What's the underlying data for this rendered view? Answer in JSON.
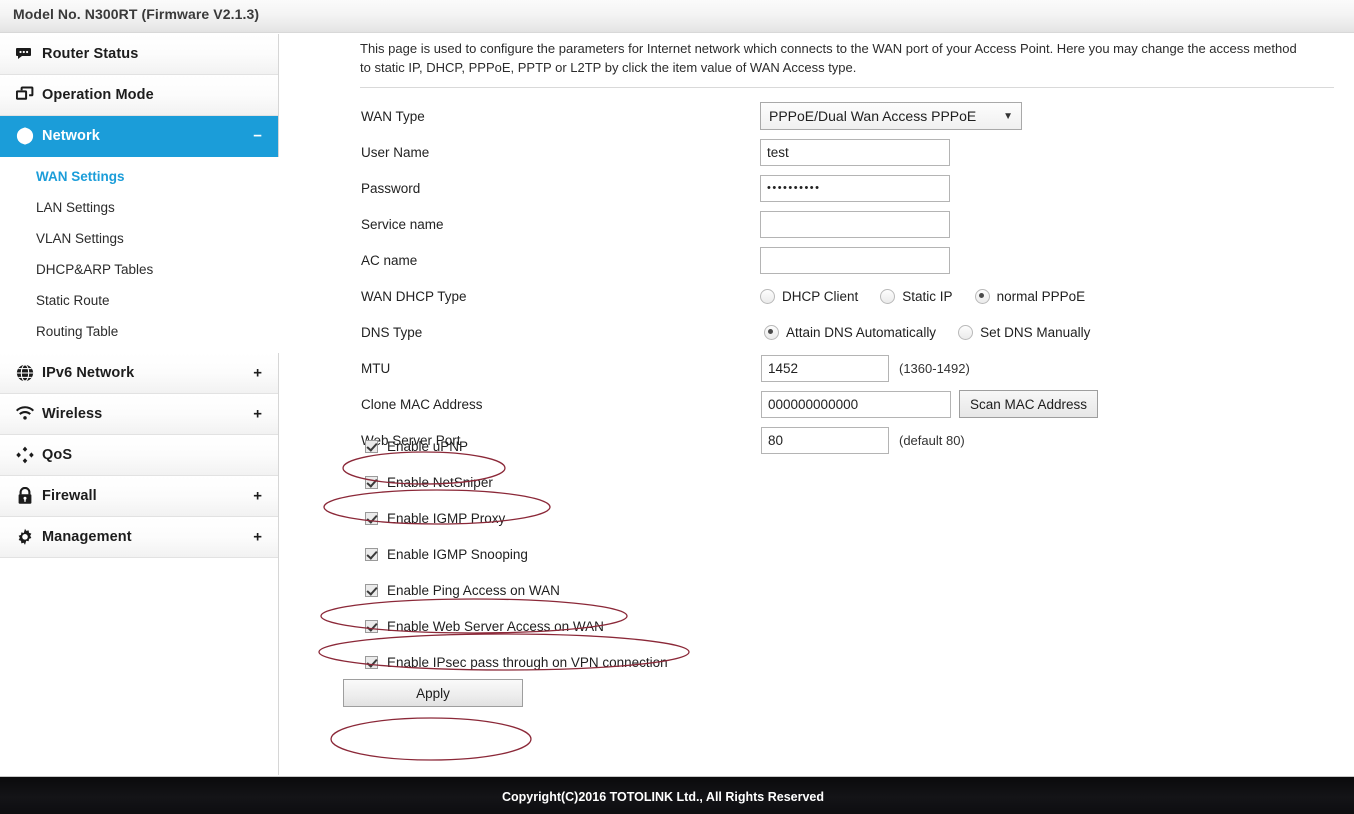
{
  "topbar": {
    "model_text": "Model No. N300RT (Firmware V2.1.3)"
  },
  "colors": {
    "accent": "#1b9dd9",
    "annotation": "#8b2838",
    "footer_bg": "#0d0d10",
    "link": "#1b9dd9"
  },
  "sidebar": {
    "groups": [
      {
        "label": "Router Status",
        "icon": "chat-bubble-icon",
        "toggle": "",
        "active": false,
        "subitems": []
      },
      {
        "label": "Operation Mode",
        "icon": "windows-icon",
        "toggle": "",
        "active": false,
        "subitems": []
      },
      {
        "label": "Network",
        "icon": "globe-icon",
        "toggle": "−",
        "active": true,
        "subitems": [
          {
            "label": "WAN Settings",
            "selected": true
          },
          {
            "label": "LAN Settings",
            "selected": false
          },
          {
            "label": "VLAN Settings",
            "selected": false
          },
          {
            "label": "DHCP&ARP Tables",
            "selected": false
          },
          {
            "label": "Static Route",
            "selected": false
          },
          {
            "label": "Routing Table",
            "selected": false
          }
        ]
      },
      {
        "label": "IPv6 Network",
        "icon": "globe-icon",
        "toggle": "+",
        "active": false,
        "subitems": []
      },
      {
        "label": "Wireless",
        "icon": "wifi-icon",
        "toggle": "+",
        "active": false,
        "subitems": []
      },
      {
        "label": "QoS",
        "icon": "diamonds-icon",
        "toggle": "",
        "active": false,
        "subitems": []
      },
      {
        "label": "Firewall",
        "icon": "lock-icon",
        "toggle": "+",
        "active": false,
        "subitems": []
      },
      {
        "label": "Management",
        "icon": "gear-icon",
        "toggle": "+",
        "active": false,
        "subitems": []
      }
    ]
  },
  "main": {
    "description": "This page is used to configure the parameters for Internet network which connects to the WAN port of your Access Point. Here you may change the access method to static IP, DHCP, PPPoE, PPTP or L2TP by click the item value of WAN Access type.",
    "fields": {
      "wan_type": {
        "label": "WAN Type",
        "value": "PPPoE/Dual Wan Access PPPoE",
        "caret": "▼"
      },
      "user_name": {
        "label": "User Name",
        "value": "test",
        "placeholder": ""
      },
      "password": {
        "label": "Password",
        "value": "••••••••••",
        "placeholder": ""
      },
      "service_name": {
        "label": "Service name",
        "value": "",
        "placeholder": ""
      },
      "ac_name": {
        "label": "AC name",
        "value": "",
        "placeholder": ""
      },
      "wan_dhcp_type": {
        "label": "WAN DHCP Type",
        "options": [
          {
            "label": "DHCP Client",
            "selected": false
          },
          {
            "label": "Static IP",
            "selected": false
          },
          {
            "label": "normal PPPoE",
            "selected": true
          }
        ]
      },
      "dns_type": {
        "label": "DNS Type",
        "options": [
          {
            "label": "Attain DNS Automatically",
            "selected": true
          },
          {
            "label": "Set DNS Manually",
            "selected": false
          }
        ]
      },
      "mtu": {
        "label": "MTU",
        "value": "1452",
        "hint": "(1360-1492)"
      },
      "clone_mac": {
        "label": "Clone MAC Address",
        "value": "000000000000",
        "button": "Scan MAC Address"
      },
      "web_server_port": {
        "label": "Web Server Port",
        "value": "80",
        "hint": "(default 80)"
      }
    },
    "checkboxes": [
      {
        "label": "Enable uPNP",
        "checked": true,
        "annotated": true
      },
      {
        "label": "Enable NetSniper",
        "checked": true,
        "annotated": true
      },
      {
        "label": "Enable IGMP Proxy",
        "checked": true,
        "annotated": false
      },
      {
        "label": "Enable IGMP Snooping",
        "checked": true,
        "annotated": false
      },
      {
        "label": "Enable Ping Access on WAN",
        "checked": true,
        "annotated": true
      },
      {
        "label": "Enable Web Server Access on WAN",
        "checked": true,
        "annotated": true
      },
      {
        "label": "Enable IPsec pass through on VPN connection",
        "checked": true,
        "annotated": false
      }
    ],
    "apply_button": {
      "label": "Apply",
      "annotated": true
    }
  },
  "footer": {
    "copyright": "Copyright(C)2016 TOTOLINK Ltd., All Rights Reserved"
  }
}
